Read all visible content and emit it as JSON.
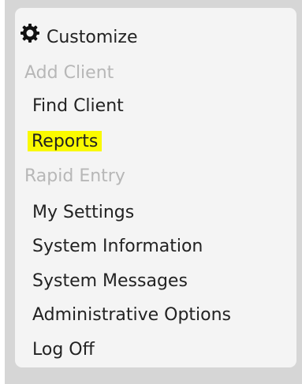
{
  "menu": {
    "header": {
      "label": "Customize",
      "icon": "gear-icon"
    },
    "items": [
      {
        "label": "Add Client",
        "enabled": false
      },
      {
        "label": "Find Client",
        "enabled": true
      },
      {
        "label": "Reports",
        "enabled": true,
        "highlighted": true
      },
      {
        "label": "Rapid Entry",
        "enabled": false
      },
      {
        "label": "My Settings",
        "enabled": true
      },
      {
        "label": "System Information",
        "enabled": true
      },
      {
        "label": "System Messages",
        "enabled": true
      },
      {
        "label": "Administrative Options",
        "enabled": true
      },
      {
        "label": "Log Off",
        "enabled": true
      }
    ]
  },
  "colors": {
    "highlight": "#fafa00",
    "disabled_text": "#b7b7b7",
    "text": "#222222",
    "panel": "#f4f4f4",
    "frame": "#d6d6d6"
  }
}
